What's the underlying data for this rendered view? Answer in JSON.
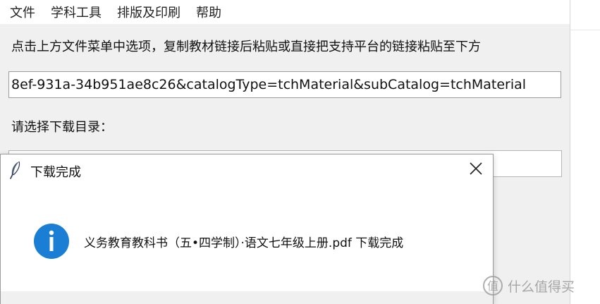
{
  "menubar": {
    "items": [
      {
        "label": "文件"
      },
      {
        "label": "学科工具"
      },
      {
        "label": "排版及印刷"
      },
      {
        "label": "帮助"
      }
    ]
  },
  "main": {
    "instruction": "点击上方文件菜单中选项，复制教材链接后粘贴或直接把支持平台的链接粘贴至下方",
    "url_value": "8ef-931a-34b951ae8c26&catalogType=tchMaterial&subCatalog=tchMaterial",
    "select_label": "请选择下载目录：",
    "dir_value": ""
  },
  "dialog": {
    "title": "下载完成",
    "message": "义务教育教科书（五•四学制）·语文七年级上册.pdf 下载完成",
    "close_icon": "close-icon",
    "app_icon": "feather-icon",
    "status_icon": "info-icon",
    "info_color": "#1a7fd4"
  },
  "watermark": {
    "text": "什么值得买"
  }
}
